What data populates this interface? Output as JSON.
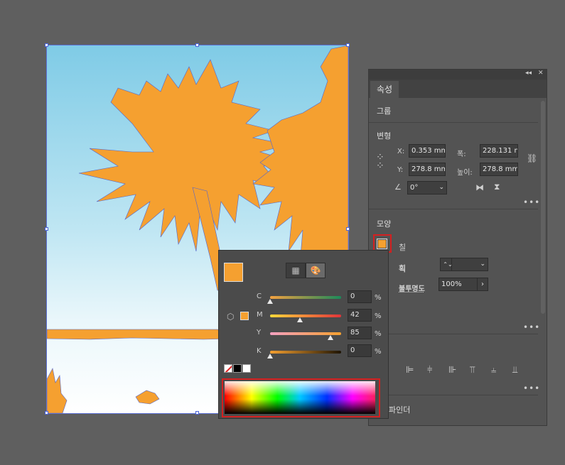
{
  "properties_panel": {
    "collapse_label": "◂◂",
    "close_label": "✕",
    "tab_label": "속성",
    "group_label": "그룹",
    "transform": {
      "title": "변형",
      "x_label": "X:",
      "x_value": "0.353 mm",
      "y_label": "Y:",
      "y_value": "278.8 mm",
      "width_label": "폭:",
      "width_value": "228.131 n",
      "height_label": "높이:",
      "height_value": "278.8 mm",
      "angle_value": "0°"
    },
    "appearance": {
      "title": "모양",
      "fill_label": "칠",
      "stroke_label": "획",
      "opacity_label": "불투명도",
      "opacity_value": "100%"
    },
    "pathfinder_label": "파인더",
    "more_label": "•••",
    "fill_color": "#f5a030"
  },
  "color_popup": {
    "current_color": "#f5a030",
    "channels": [
      {
        "label": "C",
        "value": "0",
        "unit": "%"
      },
      {
        "label": "M",
        "value": "42",
        "unit": "%"
      },
      {
        "label": "Y",
        "value": "85",
        "unit": "%"
      },
      {
        "label": "K",
        "value": "0",
        "unit": "%"
      }
    ],
    "icons": [
      "swatches-icon",
      "color-mixer-icon",
      "gamut-cube-icon"
    ]
  },
  "colors": {
    "highlight_red": "#d42020",
    "selection_blue": "#4b63d8",
    "art_orange": "#f5a030"
  }
}
